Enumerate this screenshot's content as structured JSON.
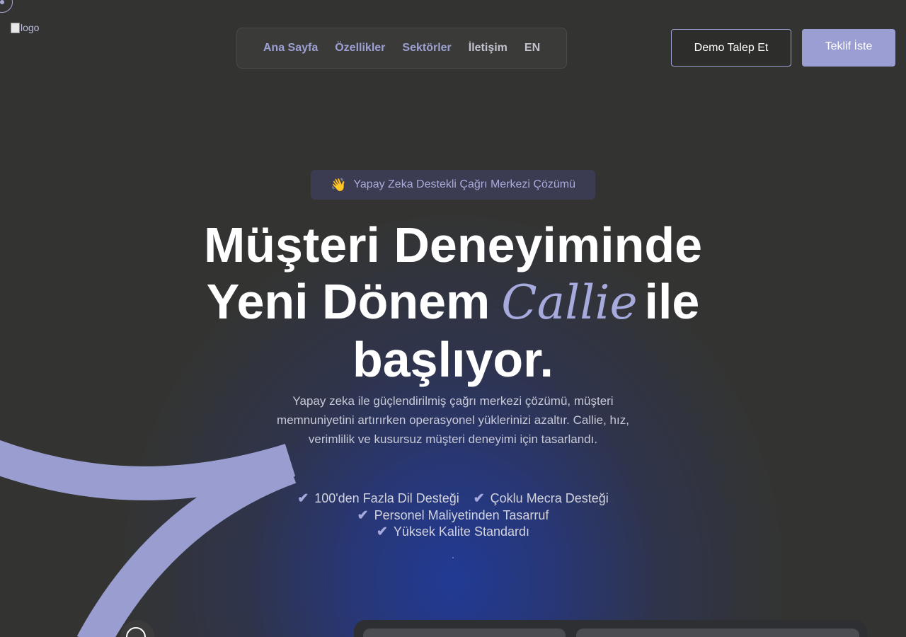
{
  "brand": {
    "logo_alt": "logo"
  },
  "nav": {
    "items": [
      {
        "label": "Ana Sayfa"
      },
      {
        "label": "Özellikler"
      },
      {
        "label": "Sektörler"
      },
      {
        "label": "İletişim"
      },
      {
        "label": "EN"
      }
    ]
  },
  "header": {
    "demo_button": "Demo Talep Et",
    "quote_button": "Teklif İste"
  },
  "hero": {
    "badge_emoji": "👋",
    "badge_text": "Yapay Zeka Destekli Çağrı Merkezi Çözümü",
    "title_line1": "Müşteri Deneyiminde",
    "title_line2_start": "Yeni Dönem",
    "title_accent": "Callie",
    "title_line2_end": "ile",
    "title_line3": "başlıyor.",
    "subtitle": "Yapay zeka ile güçlendirilmiş çağrı merkezi çözümü, müşteri memnuniyetini artırırken operasyonel yüklerinizi azaltır. Callie, hız, verimlilik ve kusursuz müşteri deneyimi için tasarlandı."
  },
  "features": [
    {
      "label": "100'den Fazla Dil Desteği"
    },
    {
      "label": "Çoklu Mecra Desteği"
    },
    {
      "label": "Personel Maliyetinden Tasarruf"
    },
    {
      "label": "Yüksek Kalite Standardı"
    }
  ],
  "colors": {
    "accent": "#9b9ed3",
    "background": "#333432",
    "glow": "#213a96"
  }
}
